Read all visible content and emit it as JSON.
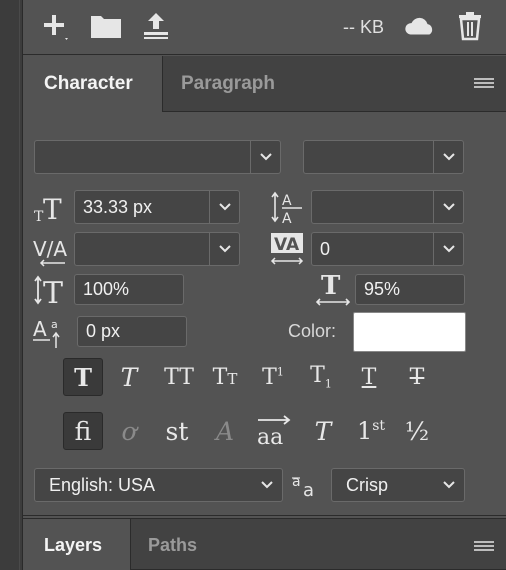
{
  "toolbar": {
    "new_icon": "plus-icon",
    "folder_icon": "folder-icon",
    "upload_icon": "upload-icon",
    "kb_label": "-- KB",
    "cloud_icon": "cloud-icon",
    "trash_icon": "trash-icon"
  },
  "tabs": [
    {
      "label": "Character",
      "active": true
    },
    {
      "label": "Paragraph",
      "active": false
    }
  ],
  "character": {
    "font_family": "",
    "font_style": "",
    "font_size": "33.33 px",
    "leading": "",
    "kerning": "",
    "tracking": "0",
    "vertical_scale": "100%",
    "horizontal_scale": "95%",
    "baseline_shift": "0 px",
    "color_label": "Color:",
    "color_value": "#ffffff",
    "language": "English: USA",
    "antialias": "Crisp"
  },
  "type_buttons_row1": [
    {
      "glyph": "T",
      "name": "faux-bold-icon",
      "active": true
    },
    {
      "glyph": "T",
      "name": "faux-italic-icon",
      "active": false
    },
    {
      "glyph": "TT",
      "name": "all-caps-icon",
      "active": false
    },
    {
      "glyph": "Tt",
      "name": "small-caps-icon",
      "active": false
    },
    {
      "glyph": "T¹",
      "name": "superscript-icon",
      "active": false
    },
    {
      "glyph": "T₁",
      "name": "subscript-icon",
      "active": false
    },
    {
      "glyph": "T",
      "name": "underline-icon",
      "active": false
    },
    {
      "glyph": "T",
      "name": "strikethrough-icon",
      "active": false
    }
  ],
  "type_buttons_row2": [
    {
      "glyph": "fi",
      "name": "standard-ligatures-icon",
      "active": true
    },
    {
      "glyph": "ơ",
      "name": "contextual-alternates-icon",
      "active": false,
      "dim": true
    },
    {
      "glyph": "st",
      "name": "discretionary-ligatures-icon",
      "active": false
    },
    {
      "glyph": "A",
      "name": "swash-icon",
      "active": false,
      "dim": true
    },
    {
      "glyph": "aa",
      "name": "stylistic-alternates-icon",
      "active": false
    },
    {
      "glyph": "T",
      "name": "titling-alternates-icon",
      "active": false
    },
    {
      "glyph": "1st",
      "name": "ordinals-icon",
      "active": false
    },
    {
      "glyph": "½",
      "name": "fractions-icon",
      "active": false
    }
  ],
  "bottom_tabs": [
    {
      "label": "Layers",
      "active": true
    },
    {
      "label": "Paths",
      "active": false
    }
  ]
}
